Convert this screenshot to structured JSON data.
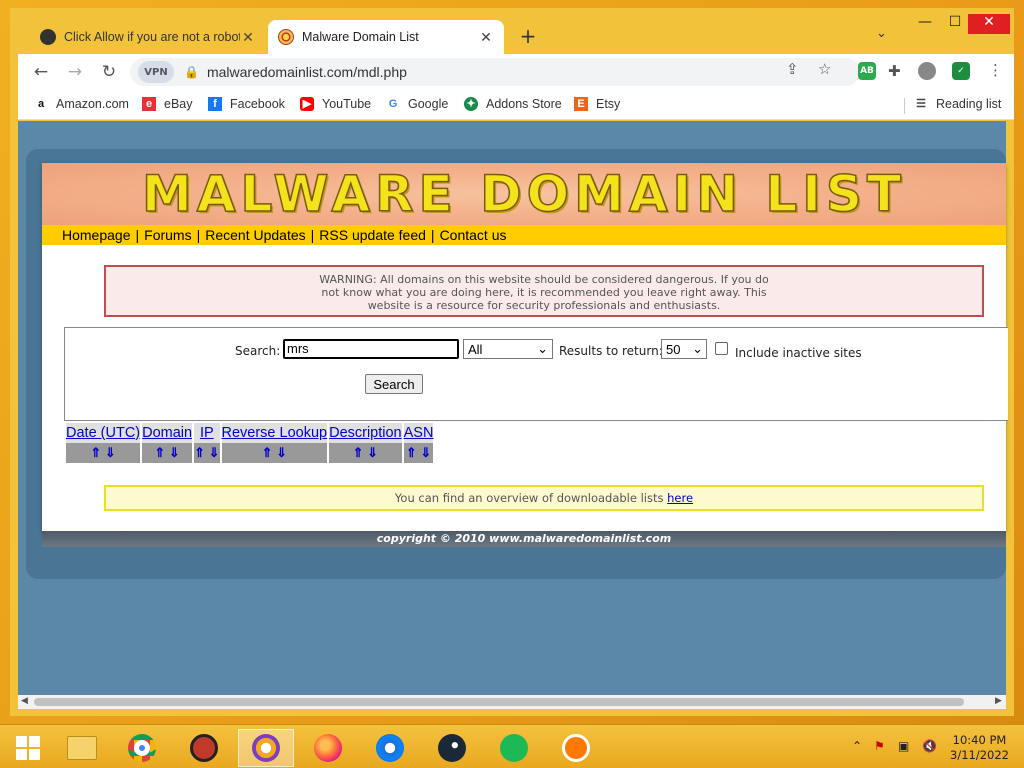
{
  "tabs": [
    {
      "title": "Click Allow if you are not a robot",
      "active": false
    },
    {
      "title": "Malware Domain List",
      "active": true
    }
  ],
  "toolbar": {
    "vpn_label": "VPN",
    "url": "malwaredomainlist.com/mdl.php",
    "ext_ab": "AB"
  },
  "bookmarks": [
    {
      "label": "Amazon.com",
      "icon": "amazon-icon"
    },
    {
      "label": "eBay",
      "icon": "ebay-icon"
    },
    {
      "label": "Facebook",
      "icon": "facebook-icon"
    },
    {
      "label": "YouTube",
      "icon": "youtube-icon"
    },
    {
      "label": "Google",
      "icon": "google-icon"
    },
    {
      "label": "Addons Store",
      "icon": "addons-store-icon"
    },
    {
      "label": "Etsy",
      "icon": "etsy-icon"
    }
  ],
  "reading_list": "Reading list",
  "site": {
    "banner_title": "MALWARE DOMAIN LIST",
    "nav": [
      "Homepage",
      "Forums",
      "Recent Updates",
      "RSS update feed",
      "Contact us"
    ],
    "warning": "WARNING: All domains on this website should be considered dangerous. If you do not know what you are doing here, it is recommended you leave right away. This website is a resource for security professionals and enthusiasts.",
    "search": {
      "label": "Search:",
      "query": "mrs",
      "filter_selected": "All",
      "results_label": "Results to return:",
      "results_selected": "50",
      "inactive_label": "Include inactive sites",
      "button": "Search"
    },
    "table_headers": [
      "Date (UTC)",
      "Domain",
      "IP",
      "Reverse Lookup",
      "Description",
      "ASN"
    ],
    "sort_arrows": "⇑ ⇓",
    "download_note_text": "You can find an overview of downloadable lists ",
    "download_note_link": "here",
    "copyright": "copyright © 2010 www.malwaredomainlist.com"
  },
  "clock": {
    "time": "10:40 PM",
    "date": "3/11/2022"
  },
  "colors": {
    "chrome_frame": "#f2c33a",
    "page_bg": "#5b88a9",
    "nav_bar": "#ffcc00",
    "banner_text": "#f4e31a"
  }
}
